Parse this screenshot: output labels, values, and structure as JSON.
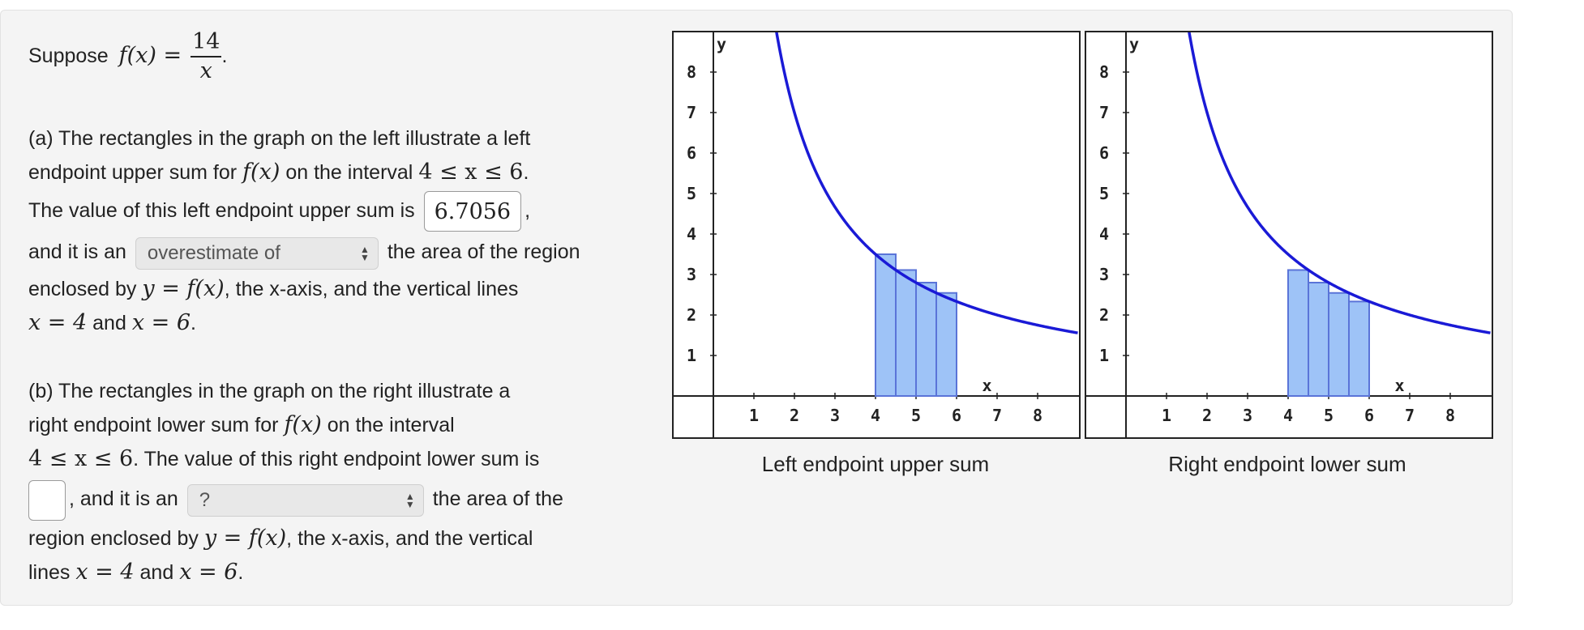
{
  "question": {
    "intro_word": "Suppose",
    "function_lhs": "f(x) =",
    "function_num": "14",
    "function_den": "x",
    "intro_end": ".",
    "part_a": {
      "line1": "(a) The rectangles in the graph on the left illustrate a left",
      "line2_pre": "endpoint upper sum for",
      "fx": "f(x)",
      "line2_mid": "on the interval",
      "interval": "4 ≤ x ≤ 6",
      "period": ".",
      "line3": "The value of this left endpoint upper sum is",
      "answer_value": "6.7056",
      "comma": ",",
      "line4_pre": "and it is an",
      "select_value": "overestimate of",
      "line4_post": "the area of the region",
      "line5_pre": "enclosed by",
      "y_eq": "y = f(x)",
      "line5_post": ", the x-axis, and the vertical lines",
      "x4": "x = 4",
      "and": "and",
      "x6": "x = 6",
      "end": "."
    },
    "part_b": {
      "line1": "(b) The rectangles in the graph on the right illustrate a",
      "line2_pre": "right endpoint lower sum for",
      "fx": "f(x)",
      "line2_post": "on the interval",
      "interval": "4 ≤ x ≤ 6",
      "line3_post": ". The value of this right endpoint lower sum is",
      "answer_value": "",
      "comma": ",",
      "line4_mid": "and it is an",
      "select_value": "?",
      "line4_post": "the area of the",
      "line5_pre": "region enclosed by",
      "y_eq": "y = f(x)",
      "line5_post": ", the x-axis, and the vertical",
      "line6_pre": "lines",
      "x4": "x = 4",
      "and": "and",
      "x6": "x = 6",
      "end": "."
    }
  },
  "graphs": {
    "left_caption": "Left endpoint upper sum",
    "right_caption": "Right endpoint lower sum",
    "x_axis_label": "x",
    "y_axis_label": "y",
    "x_ticks": [
      "1",
      "2",
      "3",
      "4",
      "5",
      "6",
      "7",
      "8"
    ],
    "y_ticks": [
      "1",
      "2",
      "3",
      "4",
      "5",
      "6",
      "7",
      "8"
    ]
  },
  "colors": {
    "curve": "#1a1ad6",
    "rect_fill": "#9ec3f7",
    "rect_stroke": "#5a74d8"
  },
  "chart_data": [
    {
      "type": "area",
      "title": "Left endpoint upper sum",
      "xlabel": "x",
      "ylabel": "y",
      "xlim": [
        0,
        9
      ],
      "ylim": [
        -1,
        9
      ],
      "curve": "y = 14/x",
      "rectangles": [
        {
          "x0": 4.0,
          "x1": 4.5,
          "height": 3.5
        },
        {
          "x0": 4.5,
          "x1": 5.0,
          "height": 3.111
        },
        {
          "x0": 5.0,
          "x1": 5.5,
          "height": 2.8
        },
        {
          "x0": 5.5,
          "x1": 6.0,
          "height": 2.545
        }
      ]
    },
    {
      "type": "area",
      "title": "Right endpoint lower sum",
      "xlabel": "x",
      "ylabel": "y",
      "xlim": [
        0,
        9
      ],
      "ylim": [
        -1,
        9
      ],
      "curve": "y = 14/x",
      "rectangles": [
        {
          "x0": 4.0,
          "x1": 4.5,
          "height": 3.111
        },
        {
          "x0": 4.5,
          "x1": 5.0,
          "height": 2.8
        },
        {
          "x0": 5.0,
          "x1": 5.5,
          "height": 2.545
        },
        {
          "x0": 5.5,
          "x1": 6.0,
          "height": 2.333
        }
      ]
    }
  ]
}
